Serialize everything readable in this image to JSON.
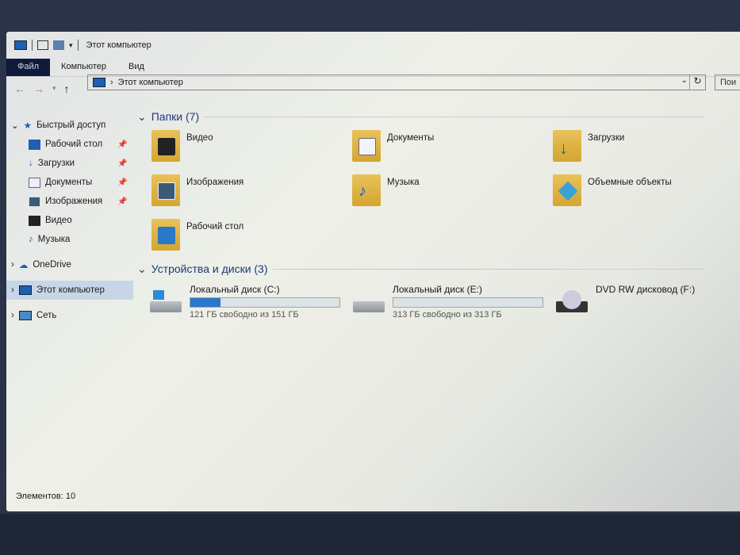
{
  "window": {
    "title": "Этот компьютер"
  },
  "ribbon": {
    "tabs": [
      "Файл",
      "Компьютер",
      "Вид"
    ]
  },
  "address": {
    "path": "Этот компьютер",
    "search_placeholder": "Пои"
  },
  "sidebar": {
    "items": [
      {
        "label": "Быстрый доступ",
        "icon": "star-icon",
        "top": true
      },
      {
        "label": "Рабочий стол",
        "icon": "desktop-icon",
        "pinned": true
      },
      {
        "label": "Загрузки",
        "icon": "download-icon",
        "pinned": true
      },
      {
        "label": "Документы",
        "icon": "documents-icon",
        "pinned": true
      },
      {
        "label": "Изображения",
        "icon": "pictures-icon",
        "pinned": true
      },
      {
        "label": "Видео",
        "icon": "video-icon"
      },
      {
        "label": "Музыка",
        "icon": "music-icon"
      },
      {
        "label": "OneDrive",
        "icon": "cloud-icon",
        "top": true
      },
      {
        "label": "Этот компьютер",
        "icon": "computer-icon",
        "top": true,
        "selected": true
      },
      {
        "label": "Сеть",
        "icon": "network-icon",
        "top": true
      }
    ]
  },
  "folders_group": {
    "title": "Папки (7)",
    "items": [
      "Видео",
      "Документы",
      "Загрузки",
      "Изображения",
      "Музыка",
      "Объемные объекты",
      "Рабочий стол"
    ]
  },
  "drives_group": {
    "title": "Устройства и диски (3)",
    "items": [
      {
        "name": "Локальный диск (C:)",
        "free": "121 ГБ свободно из 151 ГБ",
        "used_fraction": 0.2
      },
      {
        "name": "Локальный диск (E:)",
        "free": "313 ГБ свободно из 313 ГБ",
        "used_fraction": 0.0
      },
      {
        "name": "DVD RW дисковод (F:)"
      }
    ]
  },
  "status": {
    "items": "Элементов: 10"
  },
  "colors": {
    "accent": "#2a78c8",
    "file_tab": "#0f1a3a",
    "group_title": "#1c3a78"
  }
}
